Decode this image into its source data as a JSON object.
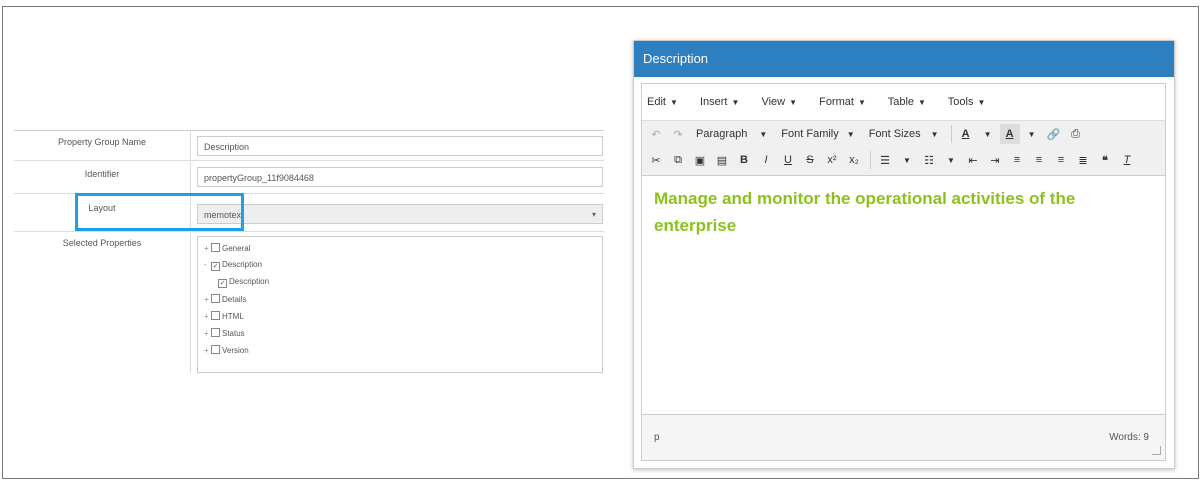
{
  "form": {
    "rows": [
      {
        "label": "Property Group Name",
        "value": "Description"
      },
      {
        "label": "Identifier",
        "value": "propertyGroup_11f9084468"
      },
      {
        "label": "Layout",
        "value": "memotext"
      },
      {
        "label": "Selected Properties"
      }
    ],
    "tree": [
      {
        "label": "General",
        "checked": false,
        "expander": "+"
      },
      {
        "label": "Description",
        "checked": true,
        "expander": "-"
      },
      {
        "label": "Description",
        "checked": true,
        "expander": ""
      },
      {
        "label": "Details",
        "checked": false,
        "expander": "+"
      },
      {
        "label": "HTML",
        "checked": false,
        "expander": "+"
      },
      {
        "label": "Status",
        "checked": false,
        "expander": "+"
      },
      {
        "label": "Version",
        "checked": false,
        "expander": "+"
      }
    ],
    "highlight_color": "#1aa1e6"
  },
  "panel": {
    "title": "Description",
    "header_color": "#2e7fc0",
    "menu": [
      "Edit",
      "Insert",
      "View",
      "Format",
      "Table",
      "Tools"
    ],
    "toolbar": {
      "block_format": "Paragraph",
      "font_family": "Font Family",
      "font_sizes": "Font Sizes",
      "text_color": "A",
      "bg_color": "A"
    },
    "content": "Manage and monitor the operational activities of the enterprise",
    "content_color": "#8cc21c",
    "status_path": "p",
    "word_count": "Words: 9"
  }
}
